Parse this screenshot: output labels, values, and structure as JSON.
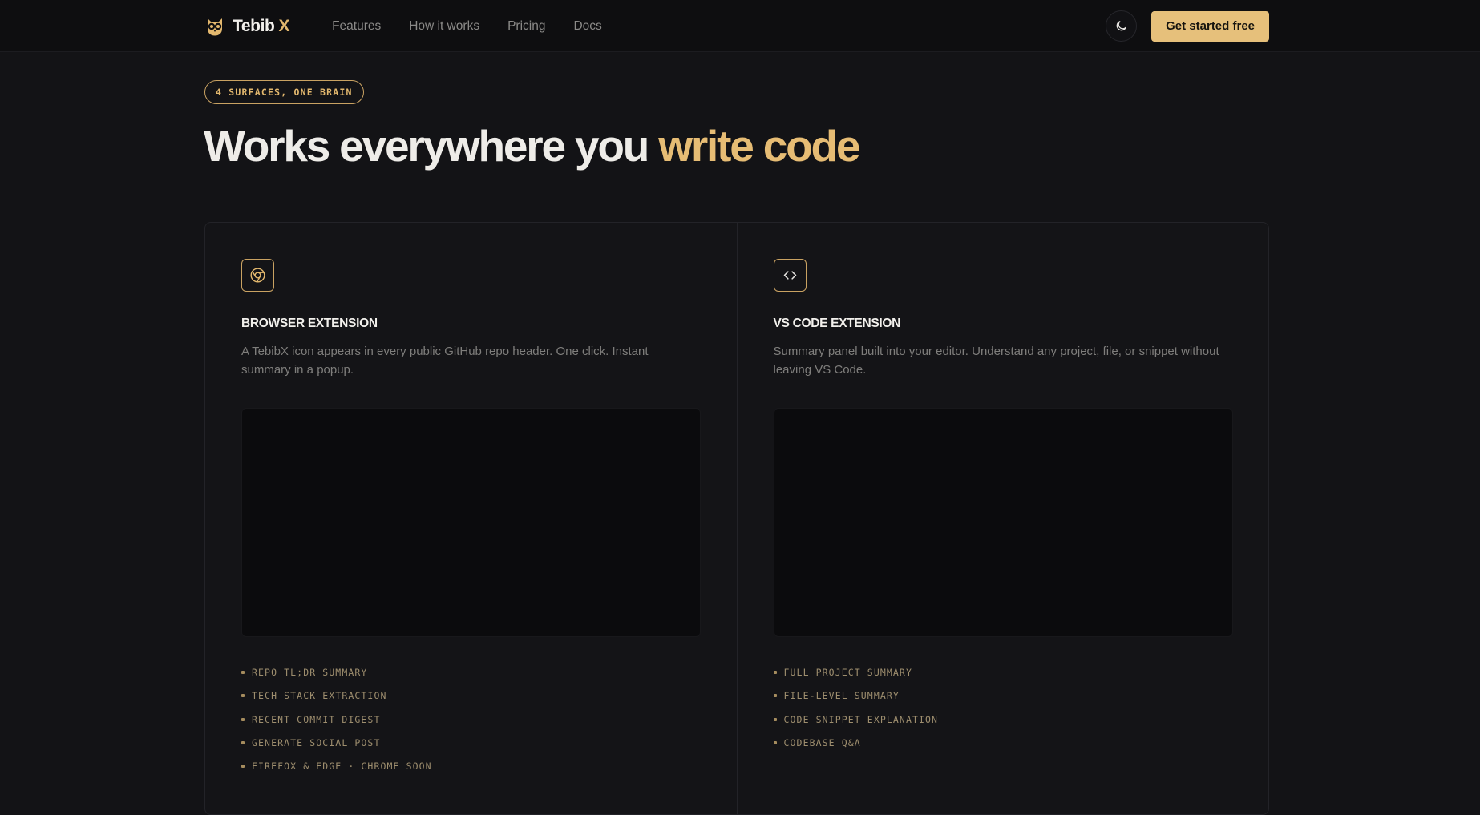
{
  "nav": {
    "brand_name": "Tebib",
    "brand_accent": "X",
    "links": [
      "Features",
      "How it works",
      "Pricing",
      "Docs"
    ],
    "theme_icon": "moon-icon",
    "cta_label": "Get started free"
  },
  "hero": {
    "eyebrow": "4 SURFACES, ONE BRAIN",
    "title_main": "Works everywhere you",
    "title_accent": "write code"
  },
  "cards": [
    {
      "icon": "chrome-icon",
      "title": "BROWSER EXTENSION",
      "description": "A TebibX icon appears in every public GitHub repo header. One click. Instant summary in a popup.",
      "features": [
        "REPO TL;DR SUMMARY",
        "TECH STACK EXTRACTION",
        "RECENT COMMIT DIGEST",
        "GENERATE SOCIAL POST",
        "FIREFOX & EDGE · CHROME SOON"
      ]
    },
    {
      "icon": "code-icon",
      "title": "VS CODE EXTENSION",
      "description": "Summary panel built into your editor. Understand any project, file, or snippet without leaving VS Code.",
      "features": [
        "FULL PROJECT SUMMARY",
        "FILE-LEVEL SUMMARY",
        "CODE SNIPPET EXPLANATION",
        "CODEBASE Q&A"
      ]
    }
  ],
  "colors": {
    "accent": "#e6c07b",
    "background": "#131316",
    "nav_background": "#0e0e10"
  }
}
